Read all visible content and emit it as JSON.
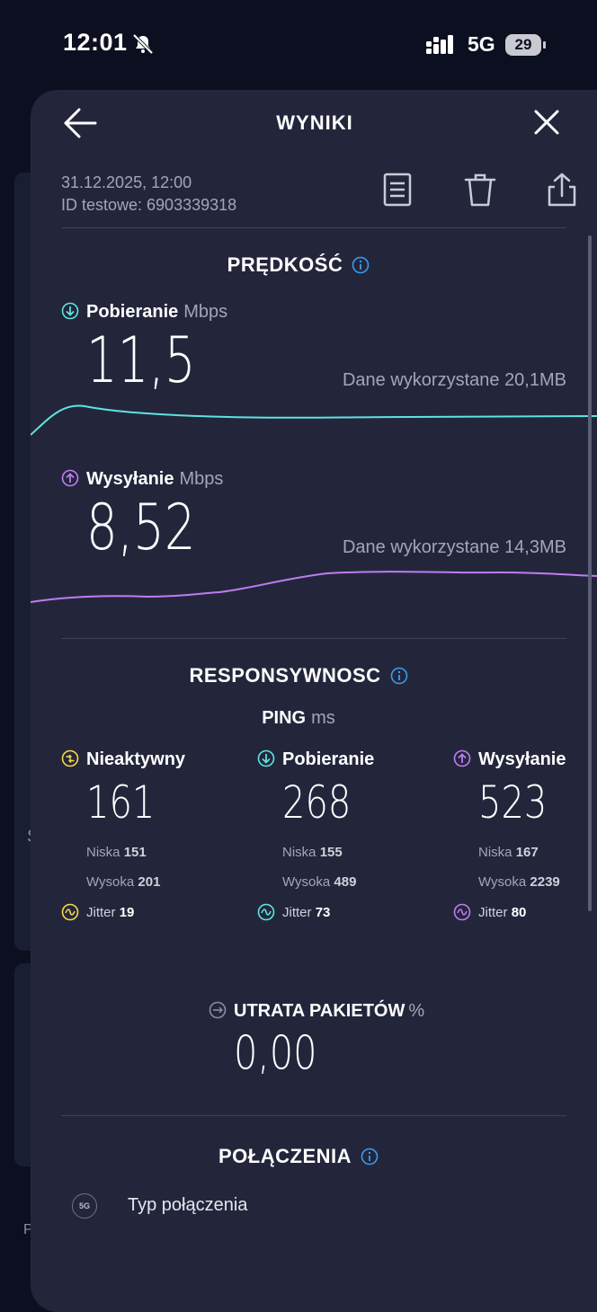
{
  "status_bar": {
    "time": "12:01",
    "network": "5G",
    "battery": "29"
  },
  "background": {
    "char1": "S",
    "char2": "P"
  },
  "header": {
    "title": "WYNIKI"
  },
  "meta": {
    "datetime": "31.12.2025, 12:00",
    "test_id": "ID testowe: 6903339318"
  },
  "speed": {
    "title": "PRĘDKOŚĆ",
    "download": {
      "label": "Pobieranie",
      "unit": "Mbps",
      "value": "11,5",
      "data_used": "Dane wykorzystane 20,1MB"
    },
    "upload": {
      "label": "Wysyłanie",
      "unit": "Mbps",
      "value": "8,52",
      "data_used": "Dane wykorzystane 14,3MB"
    }
  },
  "responsiveness": {
    "title": "RESPONSYWNOSC",
    "ping_label": "PING",
    "ping_unit": "ms",
    "columns": [
      {
        "label": "Nieaktywny",
        "value": "161",
        "low_label": "Niska",
        "low": "151",
        "high_label": "Wysoka",
        "high": "201",
        "jitter_label": "Jitter",
        "jitter": "19",
        "color": "#f5d84a"
      },
      {
        "label": "Pobieranie",
        "value": "268",
        "low_label": "Niska",
        "low": "155",
        "high_label": "Wysoka",
        "high": "489",
        "jitter_label": "Jitter",
        "jitter": "73",
        "color": "#5ee3e0"
      },
      {
        "label": "Wysyłanie",
        "value": "523",
        "low_label": "Niska",
        "low": "167",
        "high_label": "Wysoka",
        "high": "2239",
        "jitter_label": "Jitter",
        "jitter": "80",
        "color": "#c07cf2"
      }
    ]
  },
  "packet_loss": {
    "label": "UTRATA PAKIETÓW",
    "unit": "%",
    "value": "0,00"
  },
  "connections": {
    "title": "POŁĄCZENIA",
    "badge": "5G",
    "type_label": "Typ połączenia"
  },
  "colors": {
    "download": "#5ee3e0",
    "upload": "#c07cf2",
    "info": "#3a9bf0",
    "sheet": "#23263b",
    "background": "#0c0f1f"
  }
}
